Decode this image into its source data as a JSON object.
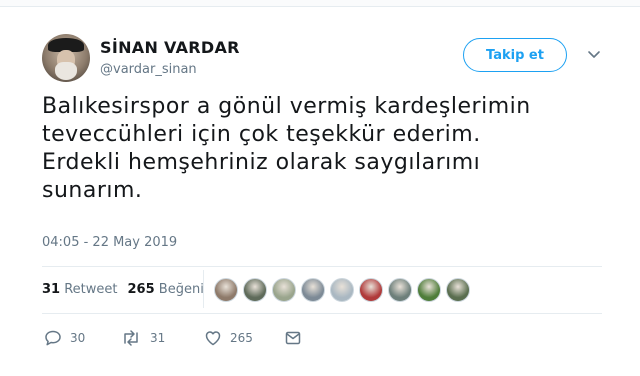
{
  "tweet": {
    "display_name": "SİNAN VARDAR",
    "handle": "@vardar_sinan",
    "follow_label": "Takip et",
    "text_lines": [
      "Balıkesirspor a gönül vermiş kardeşlerimin",
      "teveccühleri için çok teşekkür ederim.",
      "Erdekli hemşehriniz olarak saygılarımı",
      "sunarım."
    ],
    "timestamp": "04:05 - 22 May 2019"
  },
  "stats": {
    "retweet_count": "31",
    "retweet_label": "Retweet",
    "like_count": "265",
    "like_label": "Beğeni"
  },
  "likers": [
    {
      "icon": "liker-avatar",
      "color": "#8e7a6a"
    },
    {
      "icon": "liker-avatar",
      "color": "#5f6b5a"
    },
    {
      "icon": "liker-avatar",
      "color": "#9aa58d"
    },
    {
      "icon": "liker-avatar",
      "color": "#7d8a96"
    },
    {
      "icon": "default-avatar",
      "color": "#aab8c2"
    },
    {
      "icon": "liker-avatar",
      "color": "#b03a3a"
    },
    {
      "icon": "liker-avatar",
      "color": "#6d7f7a"
    },
    {
      "icon": "liker-avatar",
      "color": "#4f7d3a"
    },
    {
      "icon": "liker-avatar",
      "color": "#5a6e4f"
    }
  ],
  "actions": {
    "reply_count": "30",
    "retweet_count": "31",
    "like_count": "265"
  },
  "colors": {
    "accent": "#1da1f2",
    "muted": "#657786",
    "text": "#14171a"
  }
}
